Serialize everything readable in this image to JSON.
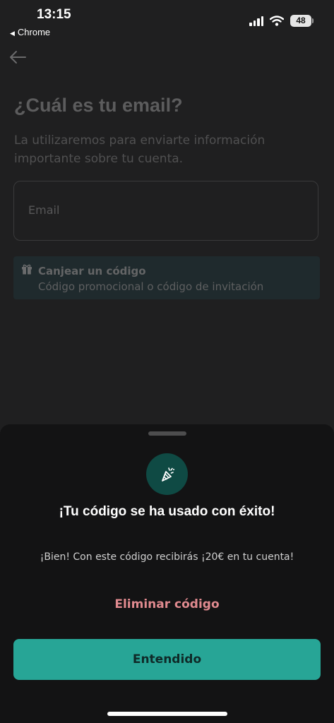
{
  "status_bar": {
    "time": "13:15",
    "back_app": "Chrome",
    "battery": "48"
  },
  "header": {
    "back_icon": "arrow-left-icon",
    "title": "¿Cuál es tu email?",
    "subtitle": "La utilizaremos para enviarte información importante sobre tu cuenta."
  },
  "form": {
    "email_placeholder": "Email",
    "email_value": ""
  },
  "promo": {
    "icon": "gift-icon",
    "title": "Canjear un código",
    "subtitle": "Código promocional o código de invitación"
  },
  "sheet": {
    "icon": "party-popper-icon",
    "title": "¡Tu código se ha usado con éxito!",
    "message": "¡Bien! Con este código recibirás ¡20€ en tu cuenta!",
    "remove_label": "Eliminar código",
    "confirm_label": "Entendido"
  },
  "colors": {
    "background": "#1f1f20",
    "sheet_background": "#131314",
    "accent": "#27a596",
    "danger_link": "#e08a8f",
    "promo_background": "#1f2a2d"
  }
}
